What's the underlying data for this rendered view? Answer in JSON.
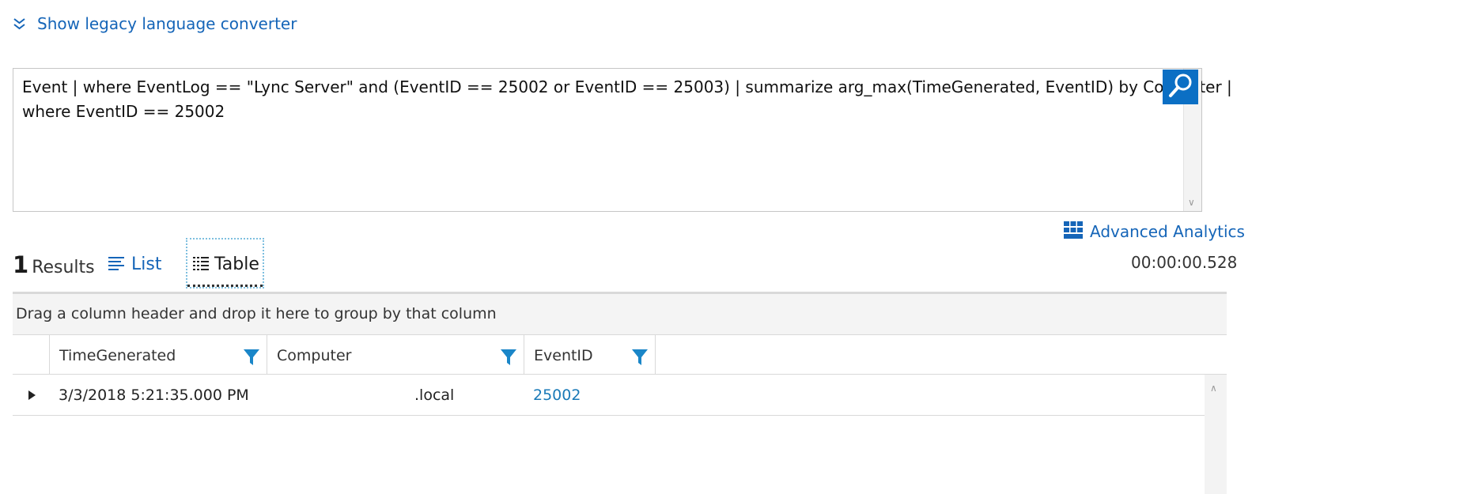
{
  "legacy": {
    "label": "Show legacy language converter"
  },
  "query": {
    "line1": "Event | where EventLog == \"Lync Server\" and (EventID == 25002 or EventID == 25003) | summarize arg_max(TimeGenerated, EventID) by Computer |",
    "line2": "where EventID == 25002"
  },
  "advanced": {
    "label": "Advanced Analytics"
  },
  "elapsed": "00:00:00.528",
  "results": {
    "count": "1",
    "label": "Results"
  },
  "tabs": {
    "list": "List",
    "table": "Table"
  },
  "grid": {
    "group_hint": "Drag a column header and drop it here to group by that column",
    "columns": [
      "TimeGenerated",
      "Computer",
      "EventID"
    ],
    "rows": [
      {
        "TimeGenerated": "3/3/2018 5:21:35.000 PM",
        "Computer": ".local",
        "EventID": "25002"
      }
    ]
  },
  "colors": {
    "accent": "#1565b8",
    "search_button": "#0b6fc4",
    "filter_icon": "#1a86c8"
  }
}
